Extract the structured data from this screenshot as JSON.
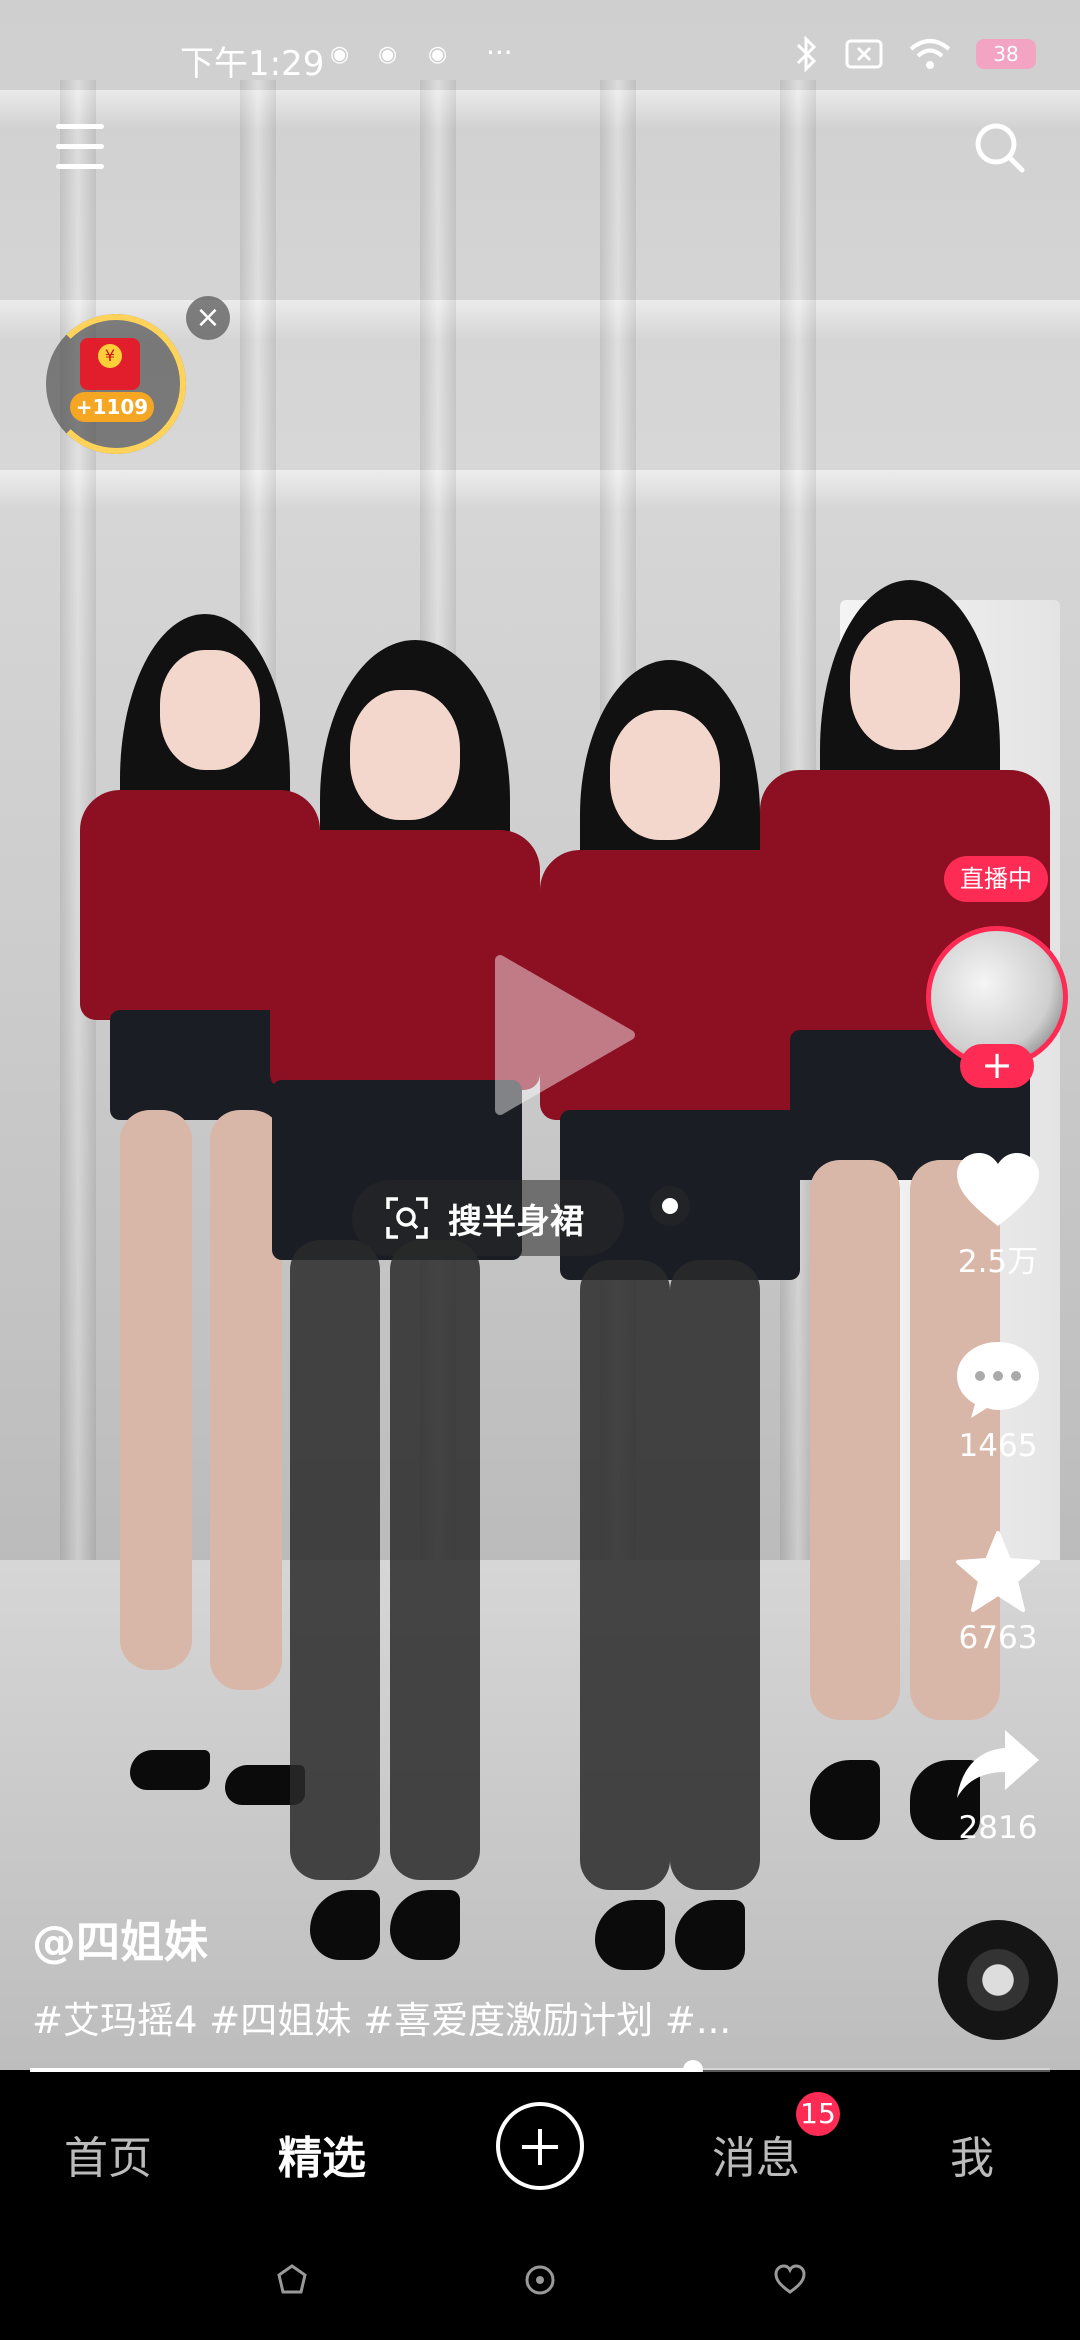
{
  "status_bar": {
    "time": "下午1:29",
    "overflow": "···",
    "battery": "38"
  },
  "top_bar": {
    "menu_icon": "menu-icon",
    "search_icon": "search-icon"
  },
  "red_packet": {
    "amount": "+1109",
    "close": "×"
  },
  "overlay": {
    "search_chip_label": "搜半身裙",
    "play_icon": "play-icon"
  },
  "side_actions": {
    "live_badge": "直播中",
    "follow_symbol": "+",
    "likes": "2.5万",
    "comments": "1465",
    "favorites": "6763",
    "shares": "2816"
  },
  "caption": {
    "author": "@四姐妹",
    "tags": "#艾玛摇4 #四姐妹 #喜爱度激励计划 #..."
  },
  "progress": {
    "value": 0.65
  },
  "bottom_nav": {
    "home": "首页",
    "featured": "精选",
    "messages": "消息",
    "messages_badge": "15",
    "me": "我"
  },
  "colors": {
    "accent": "#fe2c55",
    "background": "#000000",
    "ring": "#ffd35a"
  }
}
